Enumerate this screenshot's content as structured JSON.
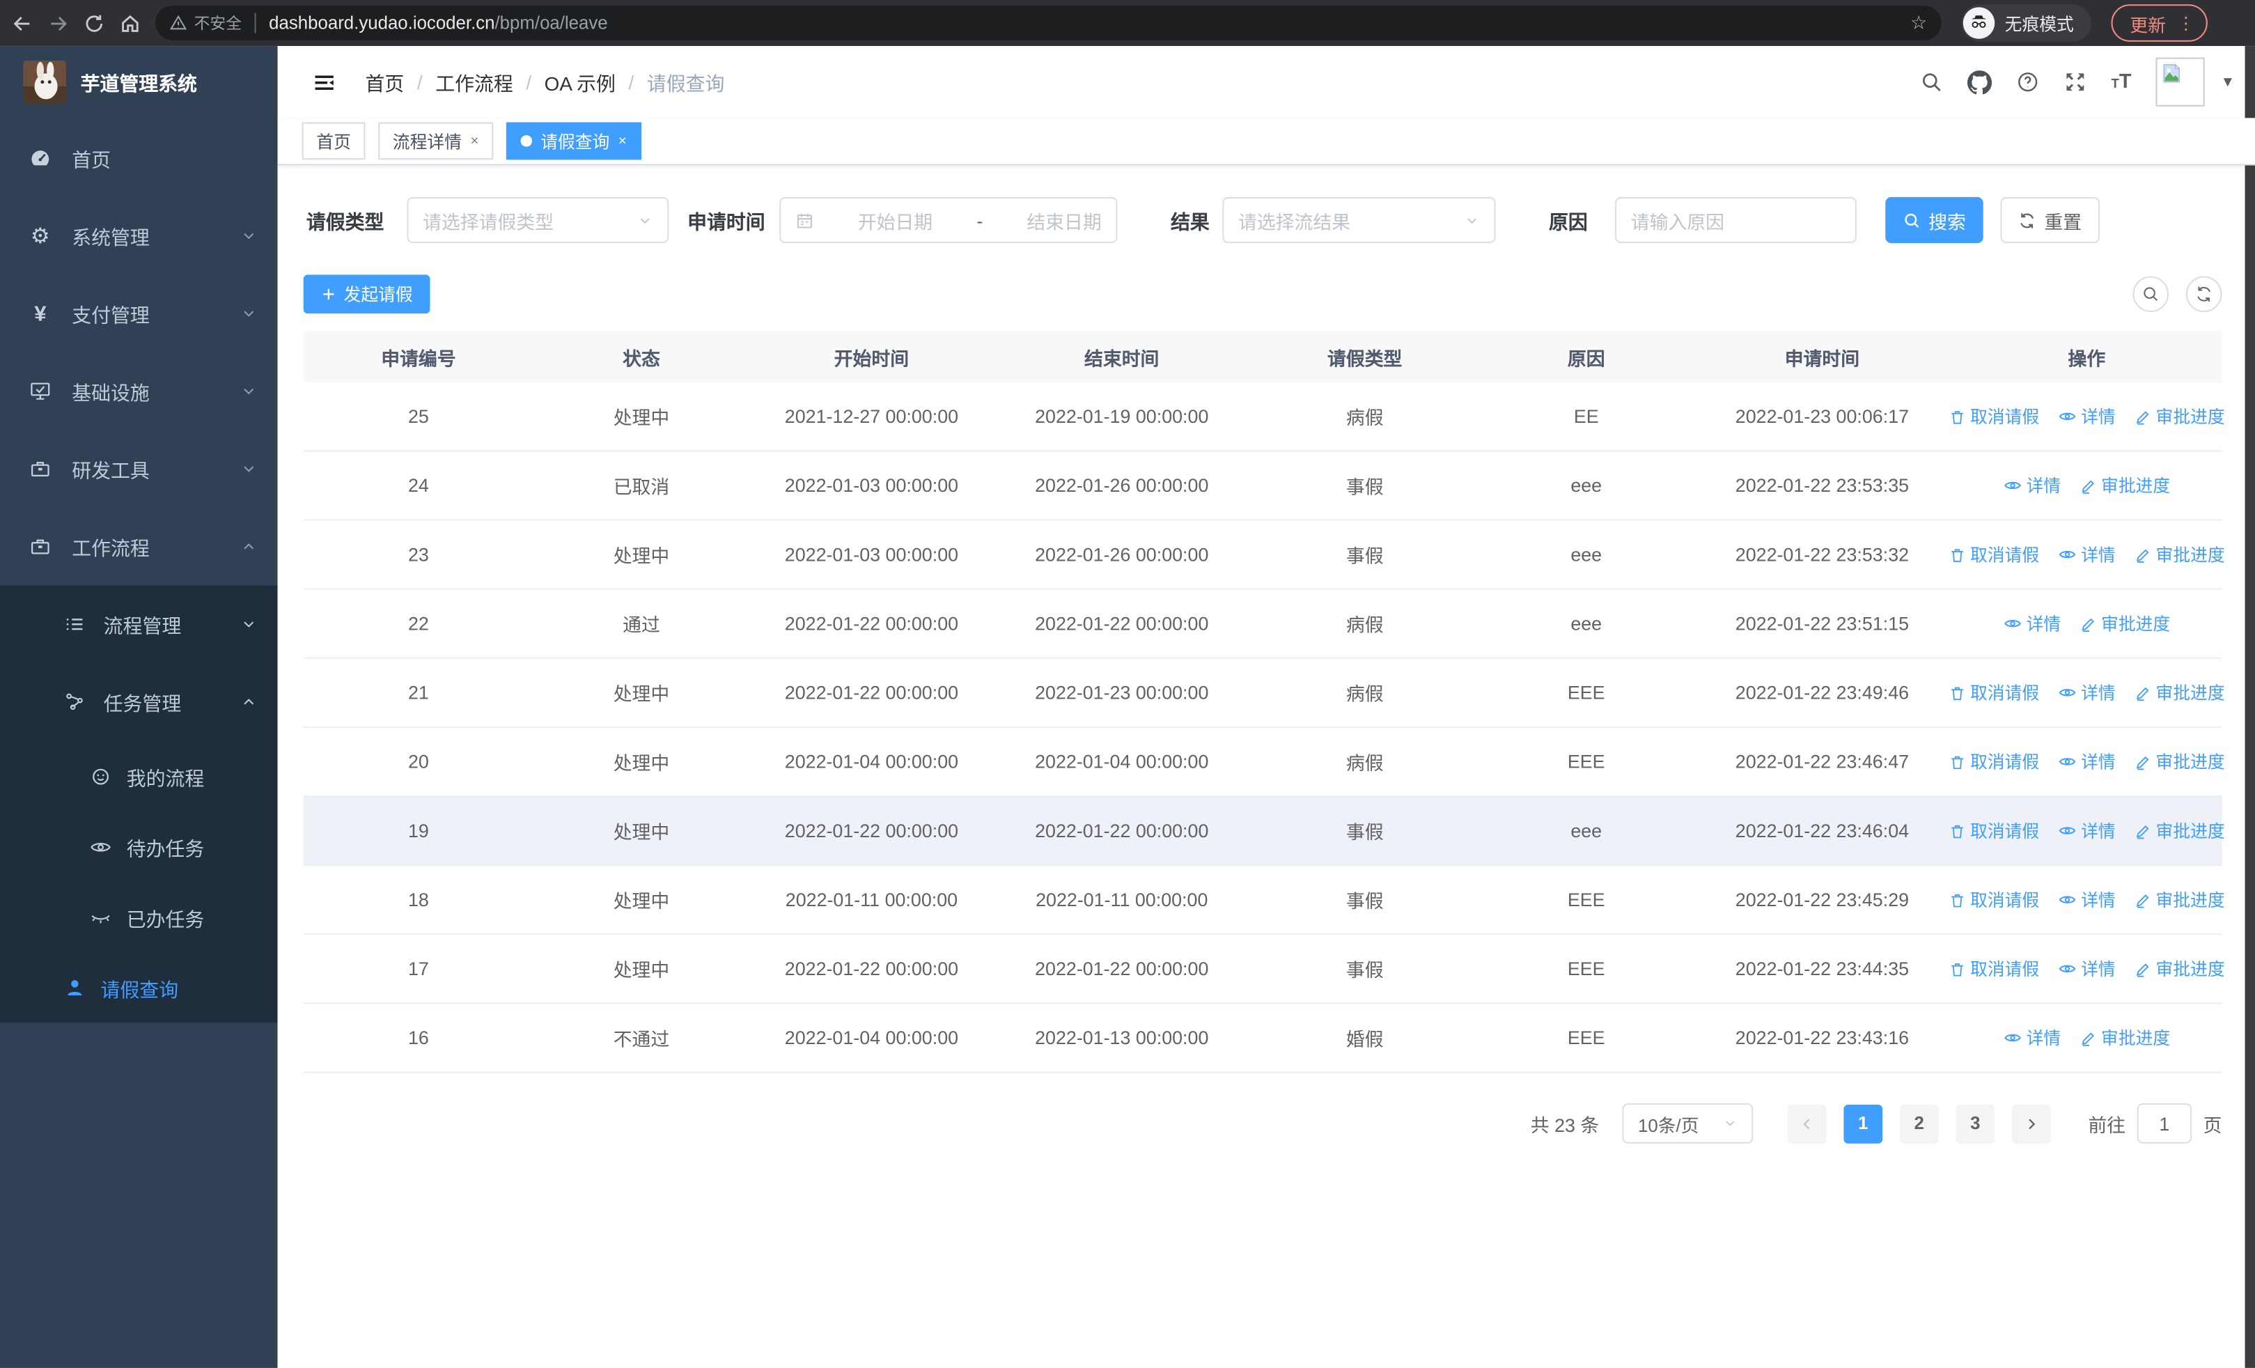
{
  "browser": {
    "secure_label": "不安全",
    "url_host": "dashboard.yudao.iocoder.cn",
    "url_path": "/bpm/oa/leave",
    "incognito_label": "无痕模式",
    "update_label": "更新",
    "more_glyph": "⋮",
    "star_glyph": "☆"
  },
  "icons": {
    "back": "left-arrow",
    "forward": "right-arrow",
    "reload": "circular-arrow",
    "home": "house",
    "warning": "triangle-exclamation",
    "incognito": "hat-and-glasses",
    "caret_down_glyph": "▼",
    "gear_glyph": "⚙",
    "yen_glyph": "¥"
  },
  "sidebar": {
    "title": "芋道管理系统",
    "items": [
      {
        "label": "首页"
      },
      {
        "label": "系统管理"
      },
      {
        "label": "支付管理"
      },
      {
        "label": "基础设施"
      },
      {
        "label": "研发工具"
      },
      {
        "label": "工作流程"
      }
    ],
    "sub_items": [
      {
        "label": "流程管理"
      },
      {
        "label": "任务管理"
      }
    ],
    "task_items": [
      {
        "label": "我的流程"
      },
      {
        "label": "待办任务"
      },
      {
        "label": "已办任务"
      }
    ],
    "leave_item": {
      "label": "请假查询"
    }
  },
  "breadcrumb": {
    "items": [
      "首页",
      "工作流程",
      "OA 示例",
      "请假查询"
    ],
    "separator": "/"
  },
  "tabs": [
    {
      "label": "首页"
    },
    {
      "label": "流程详情",
      "close": "×"
    },
    {
      "label": "请假查询",
      "close": "×"
    }
  ],
  "filters": {
    "leave_type_label": "请假类型",
    "leave_type_placeholder": "请选择请假类型",
    "apply_time_label": "申请时间",
    "start_date_placeholder": "开始日期",
    "date_separator": "-",
    "end_date_placeholder": "结束日期",
    "result_label": "结果",
    "result_placeholder": "请选择流结果",
    "reason_label": "原因",
    "reason_placeholder": "请输入原因",
    "search_label": "搜索",
    "reset_label": "重置"
  },
  "toolbar": {
    "create_label": "发起请假"
  },
  "table": {
    "headers": [
      "申请编号",
      "状态",
      "开始时间",
      "结束时间",
      "请假类型",
      "原因",
      "申请时间",
      "操作"
    ],
    "action_labels": {
      "cancel": "取消请假",
      "detail": "详情",
      "progress": "审批进度"
    },
    "rows": [
      {
        "id": "25",
        "status": "处理中",
        "start": "2021-12-27 00:00:00",
        "end": "2022-01-19 00:00:00",
        "type": "病假",
        "reason": "EE",
        "apply_time": "2022-01-23 00:06:17",
        "has_cancel": true
      },
      {
        "id": "24",
        "status": "已取消",
        "start": "2022-01-03 00:00:00",
        "end": "2022-01-26 00:00:00",
        "type": "事假",
        "reason": "eee",
        "apply_time": "2022-01-22 23:53:35",
        "has_cancel": false
      },
      {
        "id": "23",
        "status": "处理中",
        "start": "2022-01-03 00:00:00",
        "end": "2022-01-26 00:00:00",
        "type": "事假",
        "reason": "eee",
        "apply_time": "2022-01-22 23:53:32",
        "has_cancel": true
      },
      {
        "id": "22",
        "status": "通过",
        "start": "2022-01-22 00:00:00",
        "end": "2022-01-22 00:00:00",
        "type": "病假",
        "reason": "eee",
        "apply_time": "2022-01-22 23:51:15",
        "has_cancel": false
      },
      {
        "id": "21",
        "status": "处理中",
        "start": "2022-01-22 00:00:00",
        "end": "2022-01-23 00:00:00",
        "type": "病假",
        "reason": "EEE",
        "apply_time": "2022-01-22 23:49:46",
        "has_cancel": true
      },
      {
        "id": "20",
        "status": "处理中",
        "start": "2022-01-04 00:00:00",
        "end": "2022-01-04 00:00:00",
        "type": "病假",
        "reason": "EEE",
        "apply_time": "2022-01-22 23:46:47",
        "has_cancel": true
      },
      {
        "id": "19",
        "status": "处理中",
        "start": "2022-01-22 00:00:00",
        "end": "2022-01-22 00:00:00",
        "type": "事假",
        "reason": "eee",
        "apply_time": "2022-01-22 23:46:04",
        "has_cancel": true,
        "highlighted": true
      },
      {
        "id": "18",
        "status": "处理中",
        "start": "2022-01-11 00:00:00",
        "end": "2022-01-11 00:00:00",
        "type": "事假",
        "reason": "EEE",
        "apply_time": "2022-01-22 23:45:29",
        "has_cancel": true
      },
      {
        "id": "17",
        "status": "处理中",
        "start": "2022-01-22 00:00:00",
        "end": "2022-01-22 00:00:00",
        "type": "事假",
        "reason": "EEE",
        "apply_time": "2022-01-22 23:44:35",
        "has_cancel": true
      },
      {
        "id": "16",
        "status": "不通过",
        "start": "2022-01-04 00:00:00",
        "end": "2022-01-13 00:00:00",
        "type": "婚假",
        "reason": "EEE",
        "apply_time": "2022-01-22 23:43:16",
        "has_cancel": false
      }
    ]
  },
  "pagination": {
    "total_label": "共 23 条",
    "page_size_label": "10条/页",
    "pages": [
      "1",
      "2",
      "3"
    ],
    "goto_label": "前往",
    "goto_value": "1",
    "page_suffix": "页"
  }
}
